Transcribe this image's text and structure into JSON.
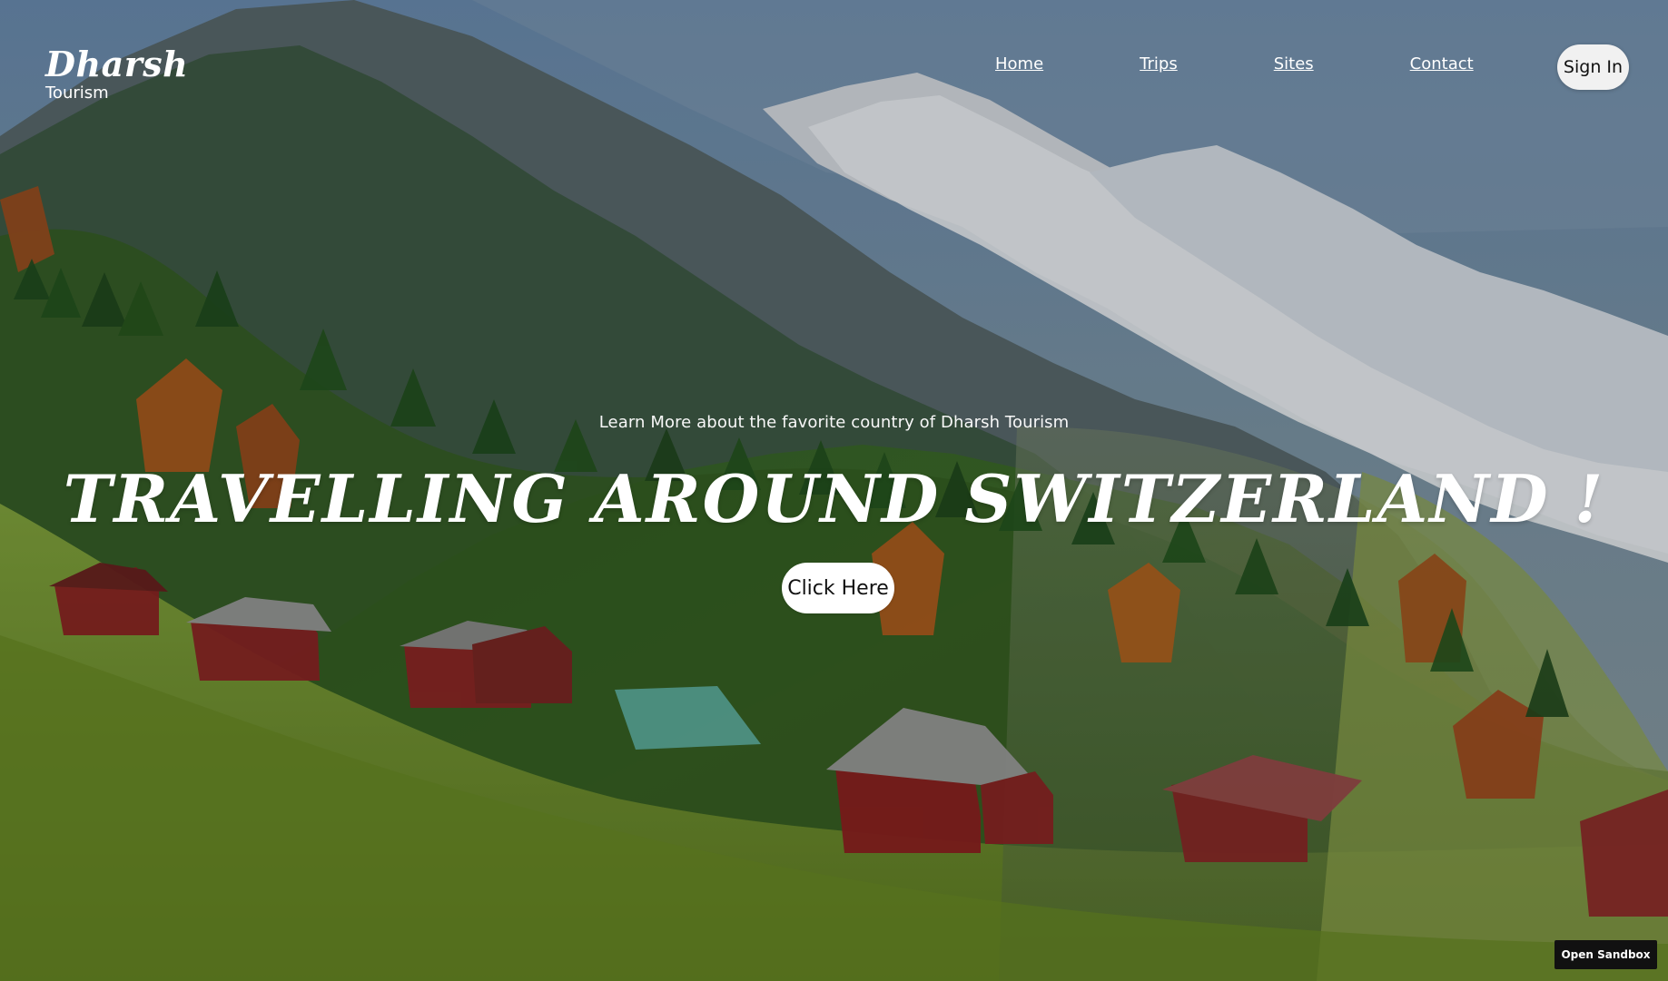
{
  "brand": {
    "title": "Dharsh",
    "subtitle": "Tourism"
  },
  "nav": {
    "links": [
      {
        "label": "Home"
      },
      {
        "label": "Trips"
      },
      {
        "label": "Sites"
      },
      {
        "label": "Contact"
      }
    ],
    "signin_label": "Sign In"
  },
  "hero": {
    "tagline": "Learn More about the favorite country of Dharsh Tourism",
    "headline": "TRAVELLING AROUND SWITZERLAND !",
    "cta_label": "Click Here"
  },
  "footer": {
    "sandbox_label": "Open Sandbox"
  },
  "colors": {
    "text_primary": "#ffffff",
    "button_light": "#f1f1f1",
    "button_dark": "#111111"
  }
}
